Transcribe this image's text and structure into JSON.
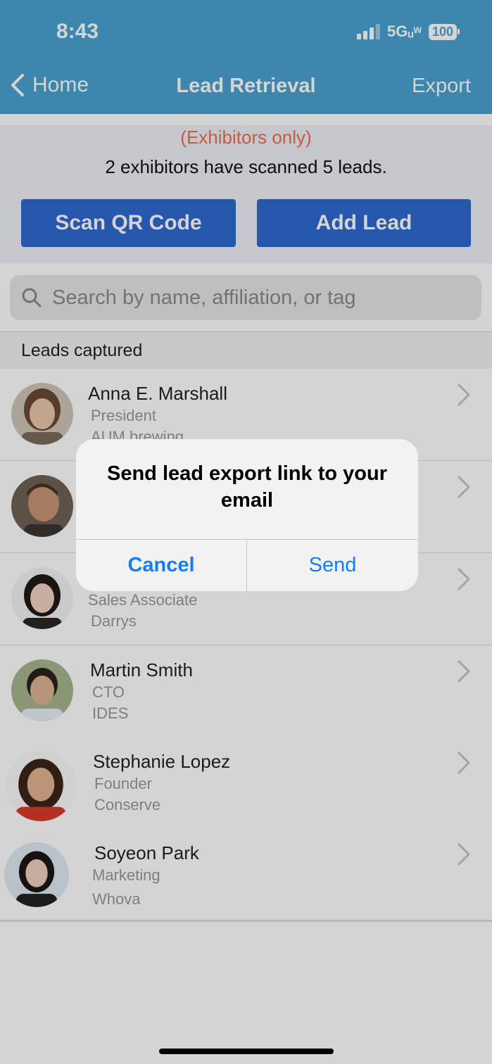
{
  "status_bar": {
    "time": "8:43",
    "network": "5Gᵤʷ",
    "battery": "100"
  },
  "nav": {
    "back_label": "Home",
    "title": "Lead Retrieval",
    "action_label": "Export"
  },
  "header": {
    "notice": "(Exhibitors only)",
    "summary": "2 exhibitors have scanned 5 leads.",
    "scan_button": "Scan QR Code",
    "add_button": "Add Lead"
  },
  "search": {
    "placeholder": "Search by name, affiliation, or tag"
  },
  "section_label": "Leads captured",
  "leads": [
    {
      "name": "Anna E. Marshall",
      "title": "President",
      "company": "AUM brewing"
    },
    {
      "name": "",
      "title": "",
      "company": ""
    },
    {
      "name": "",
      "title": "Sales Associate",
      "company": "Darrys"
    },
    {
      "name": "Martin Smith",
      "title": "CTO",
      "company": "IDES"
    },
    {
      "name": "Stephanie Lopez",
      "title": "Founder",
      "company": "Conserve"
    },
    {
      "name": "Soyeon Park",
      "title": "Marketing",
      "company": "Whova"
    }
  ],
  "alert": {
    "message": "Send lead export link to your email",
    "cancel_label": "Cancel",
    "confirm_label": "Send"
  },
  "colors": {
    "nav_bar": "#4aa3d3",
    "primary_button": "#2f69cf",
    "notice_text": "#f06d4f",
    "alert_action": "#147ef6"
  }
}
